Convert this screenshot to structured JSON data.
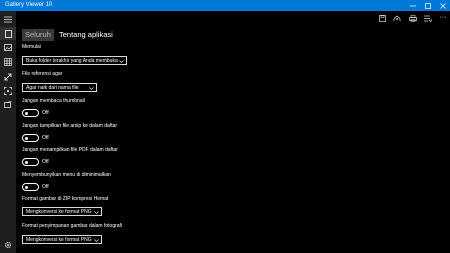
{
  "window": {
    "title": "Gallery Viewer 10",
    "minimize_icon": "minimize-icon",
    "maximize_icon": "maximize-icon",
    "close_icon": "close-icon"
  },
  "sidebar": {
    "items": [
      {
        "icon": "hamburger-menu-icon"
      },
      {
        "icon": "single-page-icon",
        "active": true
      },
      {
        "icon": "image-icon"
      },
      {
        "icon": "grid-icon"
      },
      {
        "icon": "expand-diagonal-icon"
      },
      {
        "icon": "fit-screen-icon"
      },
      {
        "icon": "slideshow-icon"
      },
      {
        "icon": "settings-gear-icon"
      }
    ]
  },
  "toolbar": {
    "icons": [
      "save-icon",
      "share-icon",
      "print-icon",
      "list-icon",
      "more-icon"
    ],
    "more_label": "···"
  },
  "tabs": [
    {
      "label": "Seluruh",
      "active": true
    },
    {
      "label": "Tentang aplikasi",
      "active": false
    }
  ],
  "settings": {
    "startup": {
      "label": "Memulai",
      "value": "Buka folder terakhir yang Anda membuka"
    },
    "sort_order": {
      "label": "File referensi agar",
      "value": "Agar naik dari nama file"
    },
    "thumbnail": {
      "label": "Jangan membaca thumbnail",
      "state": "Off"
    },
    "hide_archive": {
      "label": "Jangan tampilkan file arsip ke dalam daftar",
      "state": "Off"
    },
    "hide_pdf": {
      "label": "Jangan menampilkan file PDF dalam daftar",
      "state": "Off"
    },
    "hide_menu": {
      "label": "Menyembunyikan menu di diminimalkan",
      "state": "Off"
    },
    "zip_format": {
      "label": "Format gambar di ZIP kompresi Hemat",
      "value": "Mengkonversi ke format PNG"
    },
    "save_format": {
      "label": "Format penyimpanan gambar dalam fotografi",
      "value": "Mengkonversi ke format PNG"
    }
  },
  "colors": {
    "accent": "#0078d7",
    "background": "#000000",
    "sidebar": "#1f1f1f"
  }
}
